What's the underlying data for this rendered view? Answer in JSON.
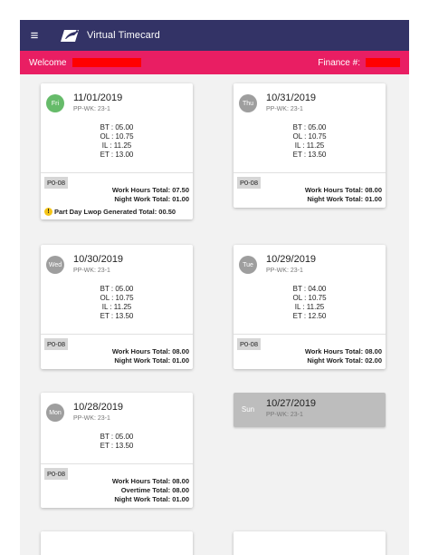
{
  "header": {
    "menu_icon": "≡",
    "title": "Virtual Timecard"
  },
  "welcome": {
    "label": "Welcome",
    "finance_label": "Finance #:"
  },
  "colors": {
    "header_bg": "#333366",
    "welcome_bg": "#e91e63",
    "redaction": "#ff0000",
    "today_circle": "#66bb6a",
    "day_circle": "#9e9e9e",
    "sunday_card": "#bdbdbd"
  },
  "cards": [
    {
      "day": "Fri",
      "date": "11/01/2019",
      "ppwk": "PP-WK: 23-1",
      "entries": [
        "BT : 05.00",
        "OL : 10.75",
        "IL : 11.25",
        "ET : 13.00"
      ],
      "op_code": "P0-08",
      "totals": [
        "Work Hours Total: 07.50",
        "Night Work Total: 01.00"
      ],
      "warning": "Part Day Lwop Generated Total: 00.50"
    },
    {
      "day": "Thu",
      "date": "10/31/2019",
      "ppwk": "PP-WK: 23-1",
      "entries": [
        "BT : 05.00",
        "OL : 10.75",
        "IL : 11.25",
        "ET : 13.50"
      ],
      "op_code": "P0-08",
      "totals": [
        "Work Hours Total: 08.00",
        "Night Work Total: 01.00"
      ]
    },
    {
      "day": "Wed",
      "date": "10/30/2019",
      "ppwk": "PP-WK: 23-1",
      "entries": [
        "BT : 05.00",
        "OL : 10.75",
        "IL : 11.25",
        "ET : 13.50"
      ],
      "op_code": "P0-08",
      "totals": [
        "Work Hours Total: 08.00",
        "Night Work Total: 01.00"
      ]
    },
    {
      "day": "Tue",
      "date": "10/29/2019",
      "ppwk": "PP-WK: 23-1",
      "entries": [
        "BT : 04.00",
        "OL : 10.75",
        "IL : 11.25",
        "ET : 12.50"
      ],
      "op_code": "P0-08",
      "totals": [
        "Work Hours Total: 08.00",
        "Night Work Total: 02.00"
      ]
    },
    {
      "day": "Mon",
      "date": "10/28/2019",
      "ppwk": "PP-WK: 23-1",
      "entries": [
        "BT : 05.00",
        "ET : 13.50"
      ],
      "op_code": "P0-08",
      "totals": [
        "Work Hours Total: 08.00",
        "Overtime Total: 08.00",
        "Night Work Total: 01.00"
      ]
    },
    {
      "day": "Sun",
      "date": "10/27/2019",
      "ppwk": "PP-WK: 23-1"
    }
  ]
}
